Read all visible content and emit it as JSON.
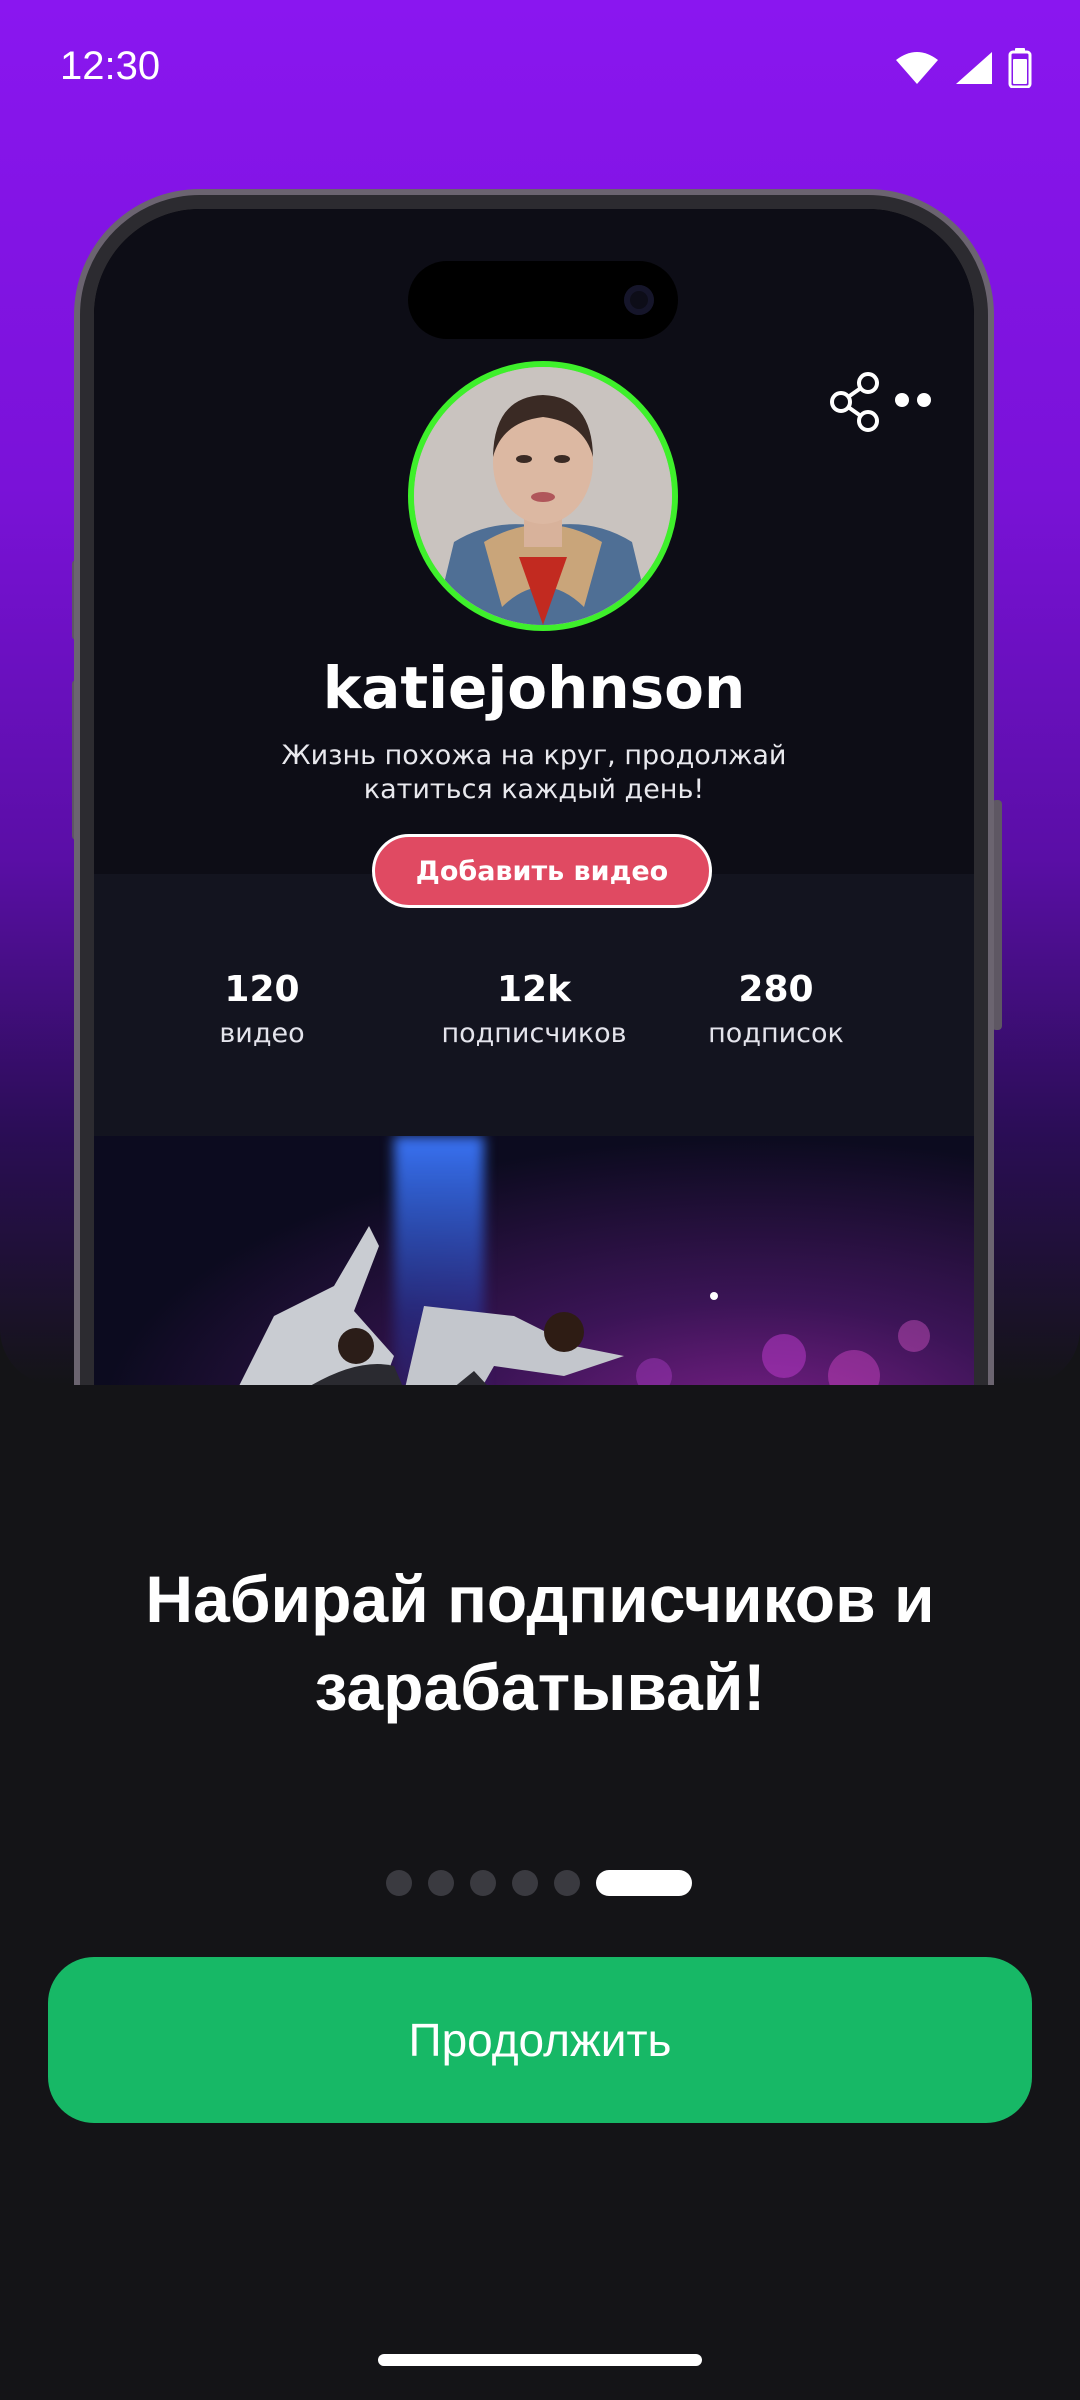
{
  "status_bar": {
    "time": "12:30",
    "icons": [
      "wifi-icon",
      "signal-icon",
      "battery-icon"
    ]
  },
  "mockup": {
    "username": "katiejohnson",
    "bio": "Жизнь похожа на круг, продолжай катиться каждый день!",
    "add_video_label": "Добавить видео",
    "avatar_ring_color": "#3ef02b",
    "stats": [
      {
        "value": "120",
        "label": "видео"
      },
      {
        "value": "12k",
        "label": "подписчиков"
      },
      {
        "value": "280",
        "label": "подписок"
      }
    ],
    "icons": [
      "share-icon",
      "more-icon"
    ]
  },
  "onboarding": {
    "headline": "Набирай подписчиков и зарабатывай!",
    "page_count": 6,
    "active_page": 6,
    "continue_label": "Продолжить"
  },
  "colors": {
    "gradient_top": "#8a16f0",
    "background": "#141417",
    "primary_button": "#17b866",
    "add_video_button": "#e04a62"
  }
}
